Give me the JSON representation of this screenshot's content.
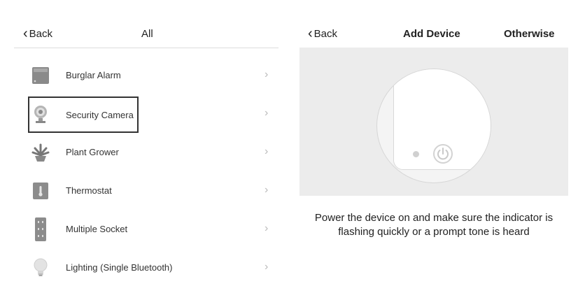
{
  "left_screen": {
    "back_label": "Back",
    "title": "All",
    "items": [
      {
        "label": "Burglar Alarm",
        "icon": "alarm-panel-icon"
      },
      {
        "label": "Security Camera",
        "icon": "camera-icon",
        "selected": true
      },
      {
        "label": "Plant Grower",
        "icon": "plant-icon"
      },
      {
        "label": "Thermostat",
        "icon": "thermostat-icon"
      },
      {
        "label": "Multiple Socket",
        "icon": "power-strip-icon"
      },
      {
        "label": "Lighting (Single Bluetooth)",
        "icon": "light-bulb-icon"
      }
    ],
    "chevron": "›"
  },
  "right_screen": {
    "back_label": "Back",
    "title": "Add Device",
    "other_label": "Otherwise",
    "instruction": "Power the device on and make sure the indicator is flashing quickly or a prompt tone is heard"
  },
  "colors": {
    "panel_bg": "#ececec",
    "selection_border": "#333333",
    "divider": "#dcdcdc"
  }
}
